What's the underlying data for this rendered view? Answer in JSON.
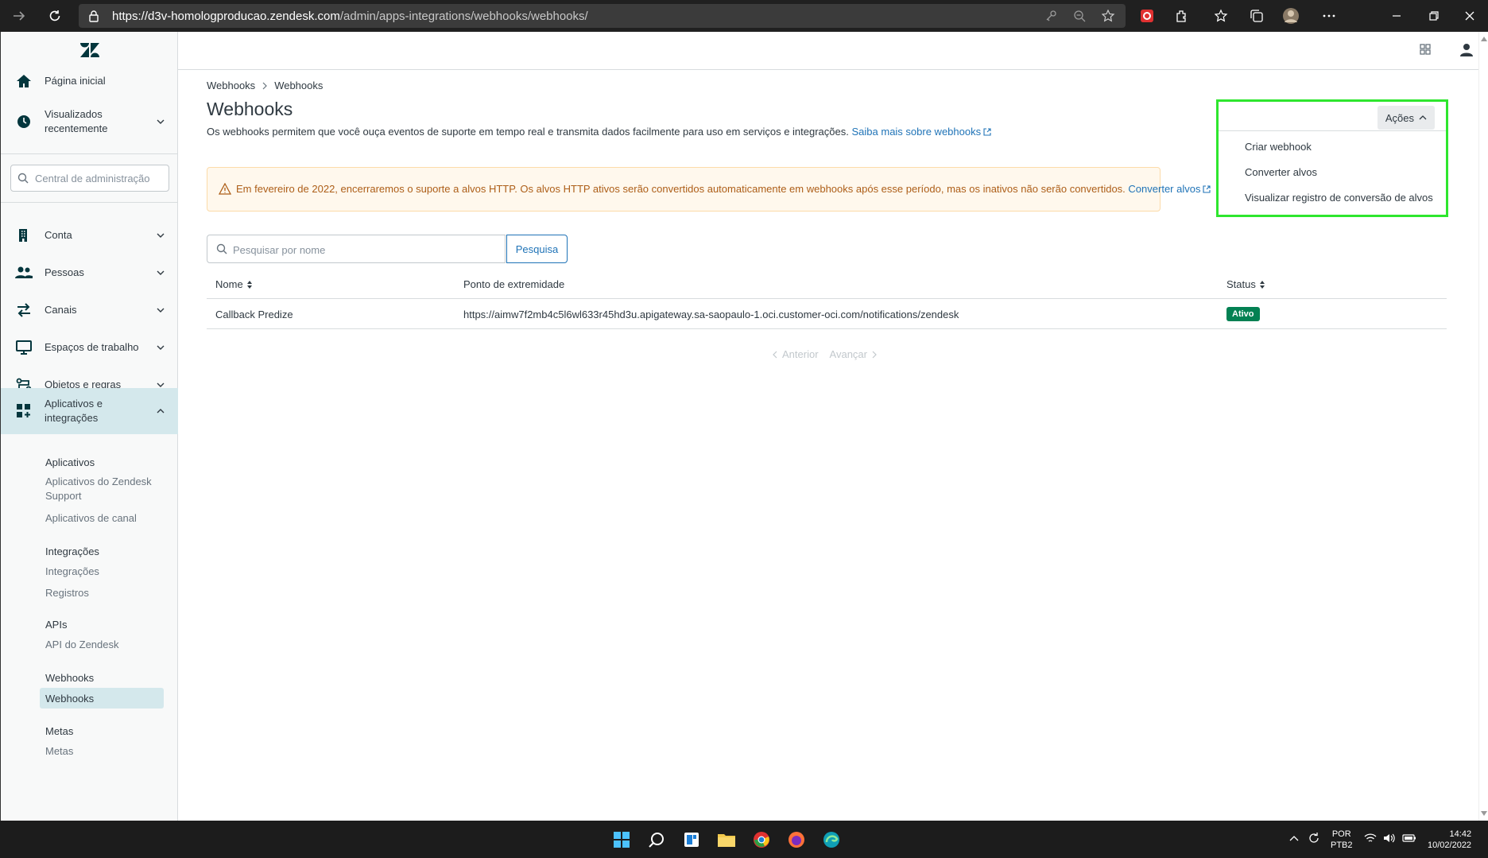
{
  "browser": {
    "url_host": "https://d3v-homologproducao.zendesk.com",
    "url_path": "/admin/apps-integrations/webhooks/webhooks/"
  },
  "sidebar": {
    "search_placeholder": "Central de administração",
    "items": [
      {
        "label": "Página inicial",
        "icon": "home-icon"
      },
      {
        "label_line1": "Visualizados",
        "label_line2": "recentemente",
        "icon": "clock-icon"
      },
      {
        "label": "Conta",
        "icon": "building-icon"
      },
      {
        "label": "Pessoas",
        "icon": "people-icon"
      },
      {
        "label": "Canais",
        "icon": "arrows-icon"
      },
      {
        "label": "Espaços de trabalho",
        "icon": "monitor-icon"
      },
      {
        "label": "Objetos e regras",
        "icon": "routing-icon"
      },
      {
        "label_line1": "Aplicativos e",
        "label_line2": "integrações",
        "icon": "apps-icon"
      }
    ],
    "submenu": {
      "aplicativos_head": "Aplicativos",
      "aplicativos_support_line1": "Aplicativos do Zendesk",
      "aplicativos_support_line2": "Support",
      "aplicativos_canal": "Aplicativos de canal",
      "integracoes_head": "Integrações",
      "integracoes_link": "Integrações",
      "registros_link": "Registros",
      "apis_head": "APIs",
      "api_link": "API do Zendesk",
      "webhooks_head": "Webhooks",
      "webhooks_link": "Webhooks",
      "metas_head": "Metas",
      "metas_link": "Metas"
    }
  },
  "main": {
    "breadcrumb": [
      "Webhooks",
      "Webhooks"
    ],
    "title": "Webhooks",
    "description": "Os webhooks permitem que você ouça eventos de suporte em tempo real e transmita dados facilmente para uso em serviços e integrações.",
    "learn_more": "Saiba mais sobre webhooks",
    "alert_text": "Em fevereiro de 2022, encerraremos o suporte a alvos HTTP. Os alvos HTTP ativos serão convertidos automaticamente em webhooks após esse período, mas os inativos não serão convertidos.",
    "alert_link": "Converter alvos",
    "search_placeholder": "Pesquisar por nome",
    "search_button": "Pesquisa",
    "table": {
      "headers": {
        "name": "Nome",
        "endpoint": "Ponto de extremidade",
        "status": "Status"
      },
      "rows": [
        {
          "name": "Callback Predize",
          "endpoint": "https://aimw7f2mb4c5l6wl633r45hd3u.apigateway.sa-saopaulo-1.oci.customer-oci.com/notifications/zendesk",
          "status": "Ativo"
        }
      ]
    },
    "pagination": {
      "prev": "Anterior",
      "next": "Avançar"
    }
  },
  "actions": {
    "button_label": "Ações",
    "menu": [
      "Criar webhook",
      "Converter alvos",
      "Visualizar registro de conversão de alvos"
    ]
  },
  "taskbar": {
    "lang_line1": "POR",
    "lang_line2": "PTB2",
    "time": "14:42",
    "date": "10/02/2022"
  },
  "colors": {
    "accent": "#1f73b7",
    "active_badge": "#038153",
    "highlight_border": "#2ee62e",
    "alert_text": "#ad5e18"
  }
}
